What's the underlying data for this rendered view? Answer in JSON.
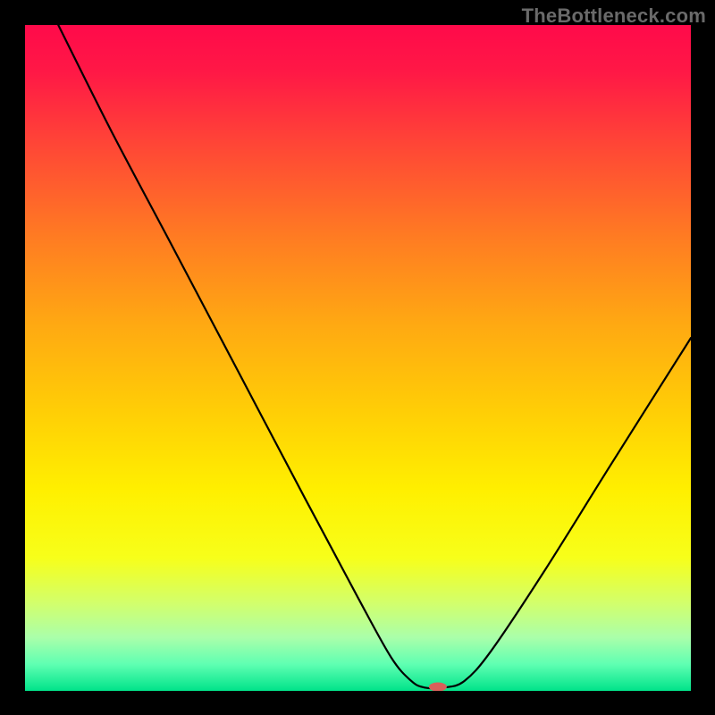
{
  "watermark": "TheBottleneck.com",
  "chart_data": {
    "type": "line",
    "title": "",
    "xlabel": "",
    "ylabel": "",
    "xlim": [
      0,
      100
    ],
    "ylim": [
      0,
      100
    ],
    "grid": false,
    "background": {
      "type": "vertical-gradient",
      "stops": [
        {
          "offset": 0.0,
          "color": "#ff0a4a"
        },
        {
          "offset": 0.07,
          "color": "#ff1846"
        },
        {
          "offset": 0.18,
          "color": "#ff4636"
        },
        {
          "offset": 0.32,
          "color": "#ff7c22"
        },
        {
          "offset": 0.45,
          "color": "#ffa912"
        },
        {
          "offset": 0.58,
          "color": "#ffce06"
        },
        {
          "offset": 0.7,
          "color": "#fff000"
        },
        {
          "offset": 0.8,
          "color": "#f7ff1a"
        },
        {
          "offset": 0.87,
          "color": "#d1ff6e"
        },
        {
          "offset": 0.92,
          "color": "#aaffaa"
        },
        {
          "offset": 0.96,
          "color": "#5fffb2"
        },
        {
          "offset": 1.0,
          "color": "#00e38a"
        }
      ]
    },
    "series": [
      {
        "name": "bottleneck-curve",
        "color": "#000000",
        "width": 2.2,
        "points": [
          {
            "x": 5.0,
            "y": 100.0
          },
          {
            "x": 13.0,
            "y": 84.0
          },
          {
            "x": 22.0,
            "y": 67.0
          },
          {
            "x": 32.0,
            "y": 48.0
          },
          {
            "x": 42.0,
            "y": 29.0
          },
          {
            "x": 50.0,
            "y": 14.0
          },
          {
            "x": 55.0,
            "y": 5.0
          },
          {
            "x": 58.0,
            "y": 1.5
          },
          {
            "x": 60.0,
            "y": 0.5
          },
          {
            "x": 63.0,
            "y": 0.5
          },
          {
            "x": 66.0,
            "y": 1.5
          },
          {
            "x": 70.0,
            "y": 6.0
          },
          {
            "x": 78.0,
            "y": 18.0
          },
          {
            "x": 88.0,
            "y": 34.0
          },
          {
            "x": 100.0,
            "y": 53.0
          }
        ]
      }
    ],
    "marker": {
      "name": "optimal-marker",
      "x": 62.0,
      "y": 0.6,
      "color": "#d9605a",
      "rx": 10,
      "ry": 5
    }
  }
}
